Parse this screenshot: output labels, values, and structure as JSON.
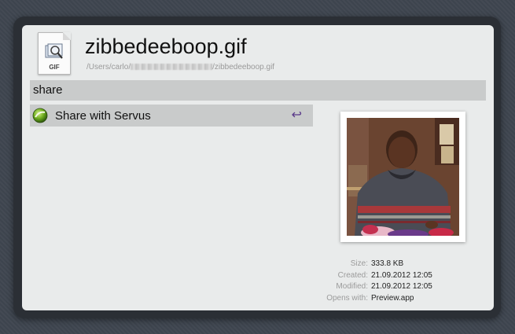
{
  "file": {
    "name": "zibbedeeboop.gif",
    "path_prefix": "/Users/carlo/",
    "path_suffix": "/zibbedeeboop.gif",
    "icon_ext": "GIF",
    "icon": "gif-file-icon"
  },
  "search": {
    "query": "share"
  },
  "results": [
    {
      "label": "Share with Servus",
      "icon": "servus-app-icon",
      "action_icon": "return-key-icon"
    }
  ],
  "preview": {
    "icon": "image-thumbnail"
  },
  "metadata": {
    "size_label": "Size:",
    "size_value": "333.8 KB",
    "created_label": "Created:",
    "created_value": "21.09.2012 12:05",
    "modified_label": "Modified:",
    "modified_value": "21.09.2012 12:05",
    "opens_label": "Opens with:",
    "opens_value": "Preview.app"
  },
  "colors": {
    "panel": "#e9ebeb",
    "highlight": "#c9cbcb",
    "frame": "#2b2f35",
    "return_icon": "#5a3a8a"
  }
}
